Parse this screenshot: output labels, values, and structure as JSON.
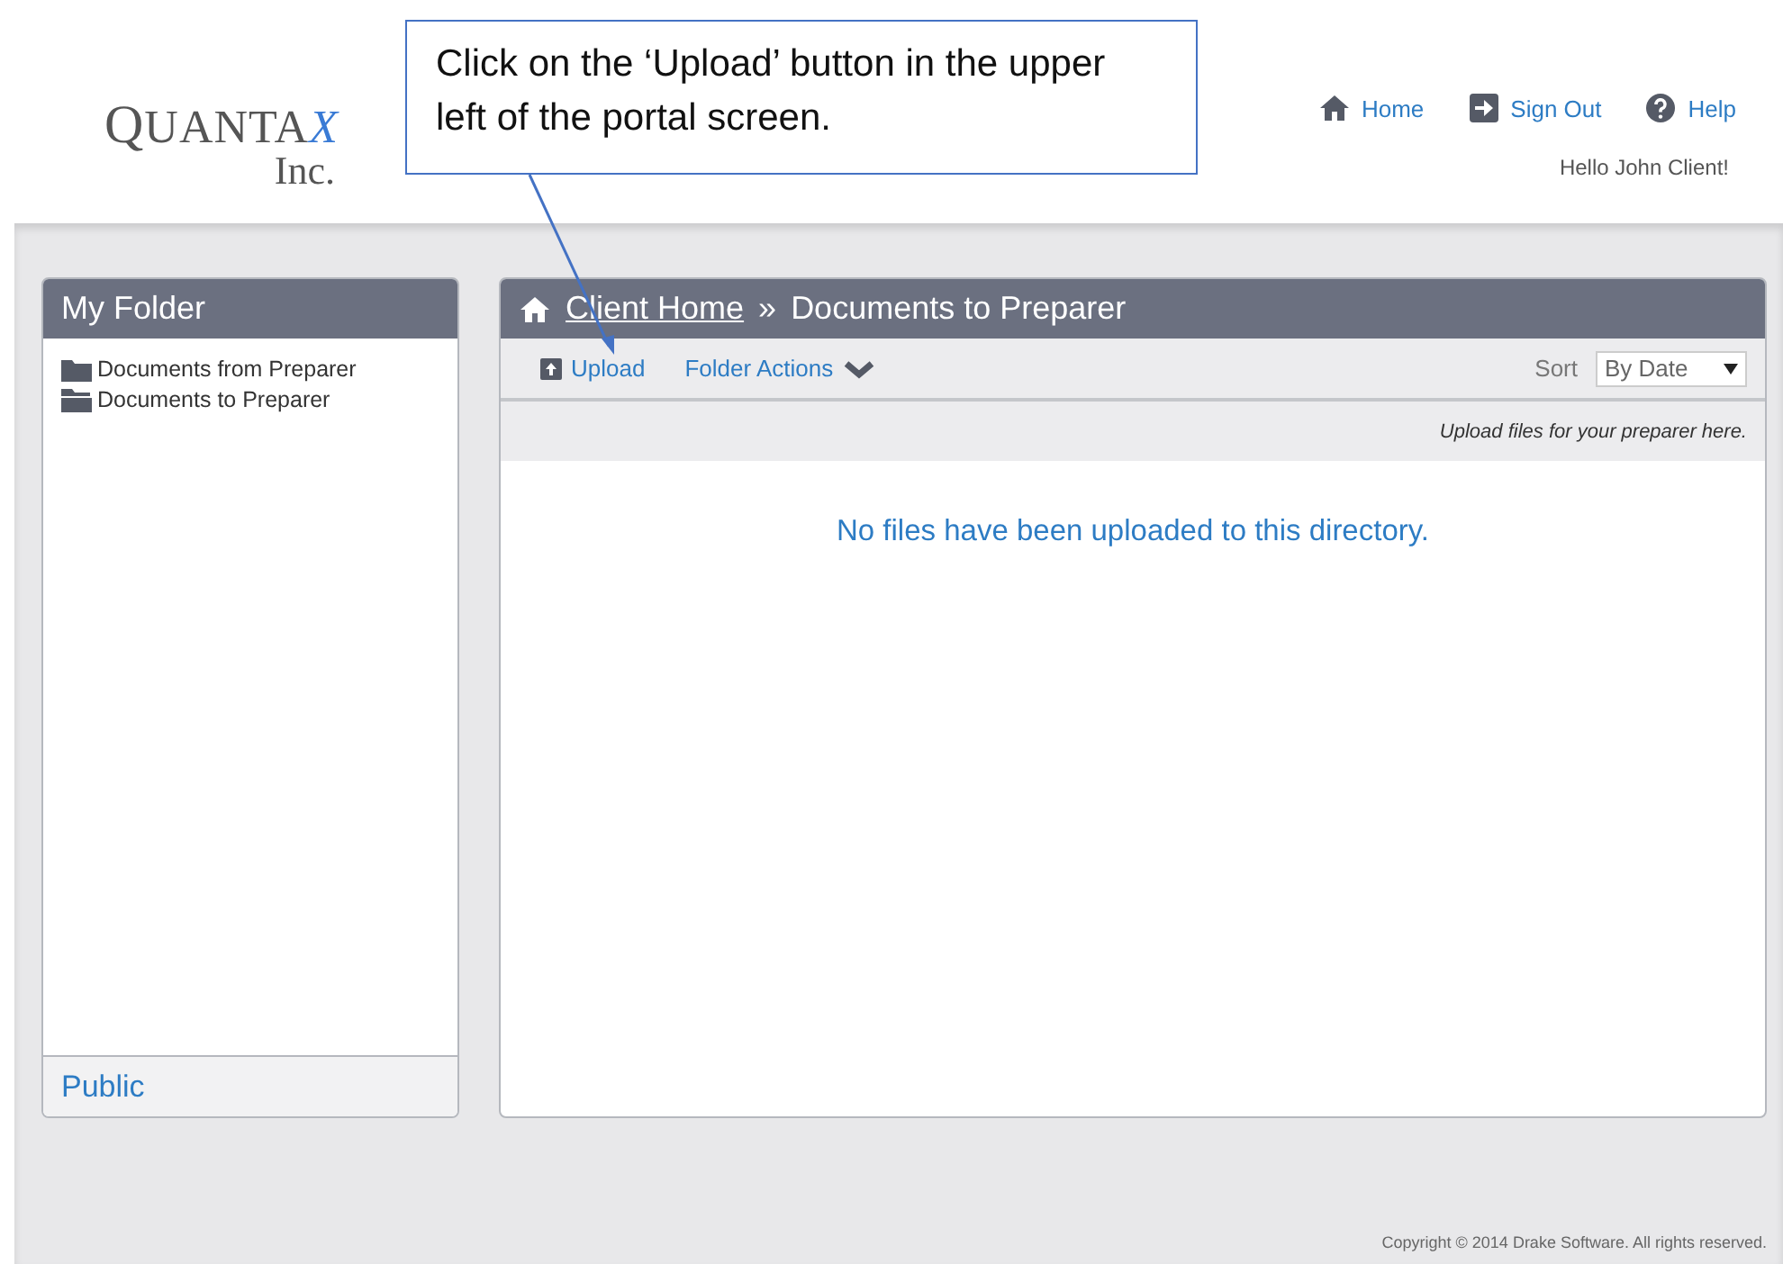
{
  "logo": {
    "name": "QUANTA",
    "mark": "X",
    "sub": "Inc."
  },
  "callout": {
    "text": "Click on the ‘Upload’ button in the upper left of the portal screen."
  },
  "nav": [
    {
      "kind": "home",
      "label": "Home"
    },
    {
      "kind": "signout",
      "label": "Sign Out"
    },
    {
      "kind": "help",
      "label": "Help"
    }
  ],
  "greeting": "Hello John Client!",
  "sidebar": {
    "title": "My Folder",
    "items": [
      {
        "kind": "closed",
        "label": "Documents from Preparer"
      },
      {
        "kind": "open",
        "label": "Documents to Preparer"
      }
    ],
    "footer": "Public"
  },
  "main": {
    "breadcrumb": {
      "link": "Client Home",
      "separator": "»",
      "current": "Documents to Preparer"
    },
    "toolbar": {
      "upload": "Upload",
      "folder_actions": "Folder Actions",
      "sort_label": "Sort",
      "sort_value": "By Date"
    },
    "hint": "Upload files for your preparer here.",
    "empty_message": "No files have been uploaded to this directory."
  },
  "footer": "Copyright © 2014 Drake Software. All rights reserved."
}
